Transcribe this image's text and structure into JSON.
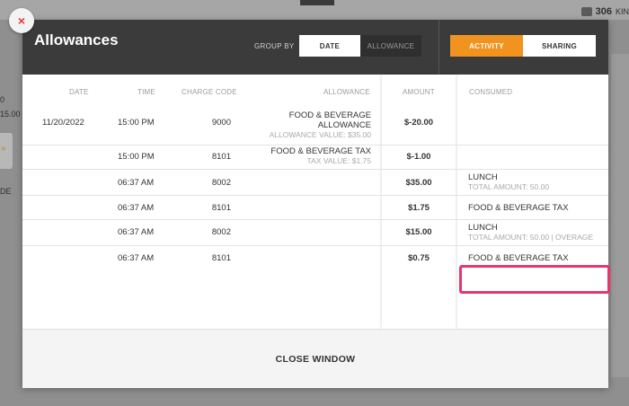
{
  "background": {
    "counter": "306",
    "counter_suffix": "KIN",
    "left_fragments": [
      {
        "text": "0"
      },
      {
        "text": "15.00"
      },
      {
        "text": "DE"
      }
    ],
    "left_box_glyph": "»"
  },
  "close_x": "×",
  "modal": {
    "title": "Allowances",
    "group_by": {
      "label": "GROUP BY",
      "options": [
        "DATE",
        "ALLOWANCE"
      ],
      "selected": "DATE"
    },
    "view_tabs": {
      "options": [
        "ACTIVITY",
        "SHARING"
      ],
      "selected": "ACTIVITY",
      "accent": "#f0941f"
    },
    "columns": {
      "date": "DATE",
      "time": "TIME",
      "charge_code": "CHARGE CODE",
      "allowance": "ALLOWANCE",
      "amount": "AMOUNT",
      "consumed": "CONSUMED"
    },
    "rows": [
      {
        "date": "11/20/2022",
        "time": "15:00 PM",
        "charge_code": "9000",
        "allowance_line1": "FOOD & BEVERAGE",
        "allowance_line2": "ALLOWANCE",
        "allowance_sub": "ALLOWANCE VALUE: $35.00",
        "amount": "$-20.00",
        "consumed": "",
        "consumed_sub": ""
      },
      {
        "date": "",
        "time": "15:00 PM",
        "charge_code": "8101",
        "allowance_line1": "FOOD & BEVERAGE TAX",
        "allowance_line2": "",
        "allowance_sub": "TAX VALUE: $1.75",
        "amount": "$-1.00",
        "consumed": "",
        "consumed_sub": ""
      },
      {
        "date": "",
        "time": "06:37 AM",
        "charge_code": "8002",
        "allowance_line1": "",
        "allowance_line2": "",
        "allowance_sub": "",
        "amount": "$35.00",
        "consumed": "LUNCH",
        "consumed_sub": "TOTAL AMOUNT: 50.00"
      },
      {
        "date": "",
        "time": "06:37 AM",
        "charge_code": "8101",
        "allowance_line1": "",
        "allowance_line2": "",
        "allowance_sub": "",
        "amount": "$1.75",
        "consumed": "FOOD & BEVERAGE TAX",
        "consumed_sub": ""
      },
      {
        "date": "",
        "time": "06:37 AM",
        "charge_code": "8002",
        "allowance_line1": "",
        "allowance_line2": "",
        "allowance_sub": "",
        "amount": "$15.00",
        "consumed": "LUNCH",
        "consumed_sub": "TOTAL AMOUNT: 50.00 | OVERAGE"
      },
      {
        "date": "",
        "time": "06:37 AM",
        "charge_code": "8101",
        "allowance_line1": "",
        "allowance_line2": "",
        "allowance_sub": "",
        "amount": "$0.75",
        "consumed": "FOOD & BEVERAGE TAX",
        "consumed_sub": ""
      }
    ],
    "close_window_label": "CLOSE WINDOW",
    "highlight_color": "#e8366b"
  }
}
